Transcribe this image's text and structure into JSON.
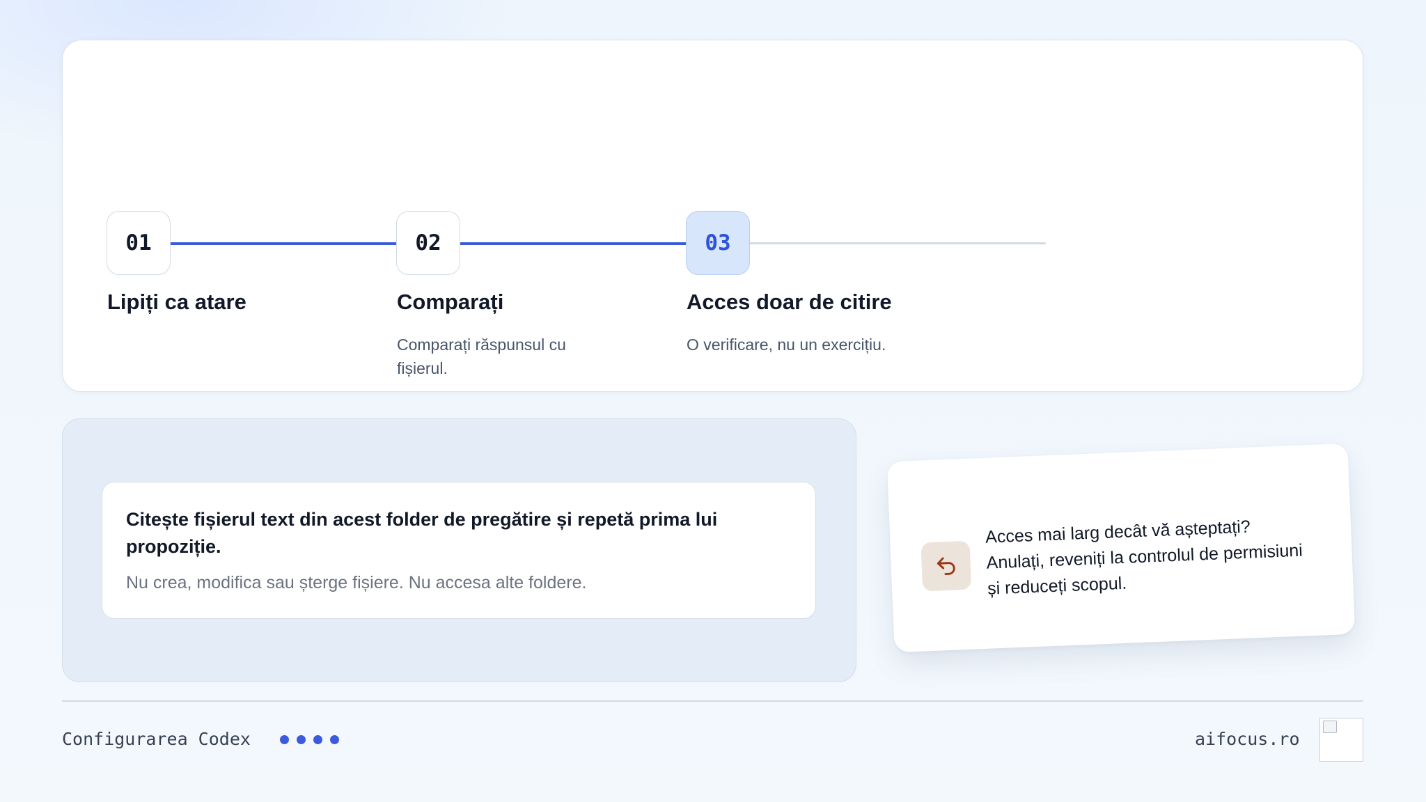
{
  "steps": [
    {
      "number": "01",
      "title": "Lipiți ca atare",
      "description": ""
    },
    {
      "number": "02",
      "title": "Comparați",
      "description": "Comparați răspunsul cu fișierul."
    },
    {
      "number": "03",
      "title": "Acces doar de citire",
      "description": "O verificare, nu un exercițiu."
    }
  ],
  "active_step": 3,
  "prompt": {
    "main": "Citește fișierul text din acest folder de pregătire și repetă prima lui propoziție.",
    "constraint": "Nu crea, modifica sau șterge fișiere. Nu accesa alte foldere."
  },
  "warning": {
    "icon": "undo-arrow-icon",
    "text": "Acces mai larg decât vă așteptați? Anulați, reveniți la controlul de permisiuni și reduceți scopul."
  },
  "footer": {
    "section": "Configurarea Codex",
    "progress_dots": 4,
    "site": "aifocus.ro"
  },
  "colors": {
    "accent": "#3b5bdb",
    "active_step_bg": "#d7e6fb",
    "warning_icon": "#9a3412"
  }
}
